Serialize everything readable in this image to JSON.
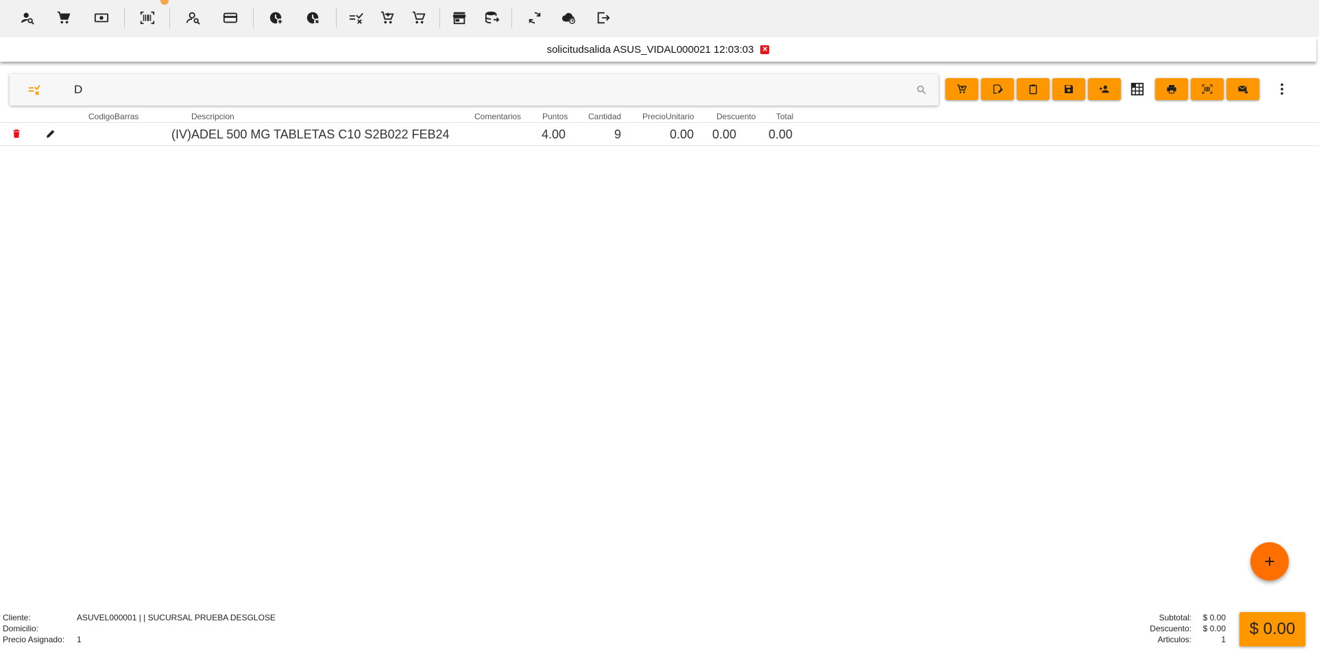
{
  "colors": {
    "accent": "#ff9800",
    "fab": "#ff6f00",
    "danger": "#e8121c",
    "toolbar_bg": "#f1f1f1"
  },
  "toolbar": {
    "icons": [
      "user-search-icon",
      "cart-icon",
      "cash-icon",
      "barcode-scan-icon",
      "user-search-icon",
      "credit-card-icon",
      "clock-plus-icon",
      "clock-cancel-icon",
      "list-check-icon",
      "cart-plus-icon",
      "cart-arrow-icon",
      "store-icon",
      "database-export-icon",
      "sync-icon",
      "cloud-clock-icon",
      "logout-icon"
    ]
  },
  "session": {
    "title": "solicitudsalida ASUS_VIDAL000021 12:03:03",
    "close_label": "✕"
  },
  "search": {
    "value": "D",
    "placeholder": ""
  },
  "table": {
    "headers": [
      "CodigoBarras",
      "Descripcion",
      "Comentarios",
      "Puntos",
      "Cantidad",
      "PrecioUnitario",
      "Descuento",
      "Total"
    ],
    "rows": [
      {
        "codigo": "",
        "descripcion": "(IV)ADEL 500 MG TABLETAS C10 S2B022 FEB24",
        "comentarios": "",
        "puntos": "4.00",
        "cantidad": "9",
        "precio": "0.00",
        "descuento": "0.00",
        "total": "0.00"
      }
    ]
  },
  "fab": {
    "label": "+"
  },
  "footer": {
    "cliente_label": "Cliente:",
    "cliente_value": "ASUVEL000001 |  | SUCURSAL PRUEBA DESGLOSE",
    "domicilio_label": "Domicilio:",
    "domicilio_value": "",
    "precio_label": "Precio Asignado:",
    "precio_value": "1",
    "subtotal_label": "Subtotal:",
    "subtotal_value": "$ 0.00",
    "descuento_label": "Descuento:",
    "descuento_value": "$ 0.00",
    "articulos_label": "Articulos:",
    "articulos_value": "1",
    "total_label": "$ 0.00"
  }
}
